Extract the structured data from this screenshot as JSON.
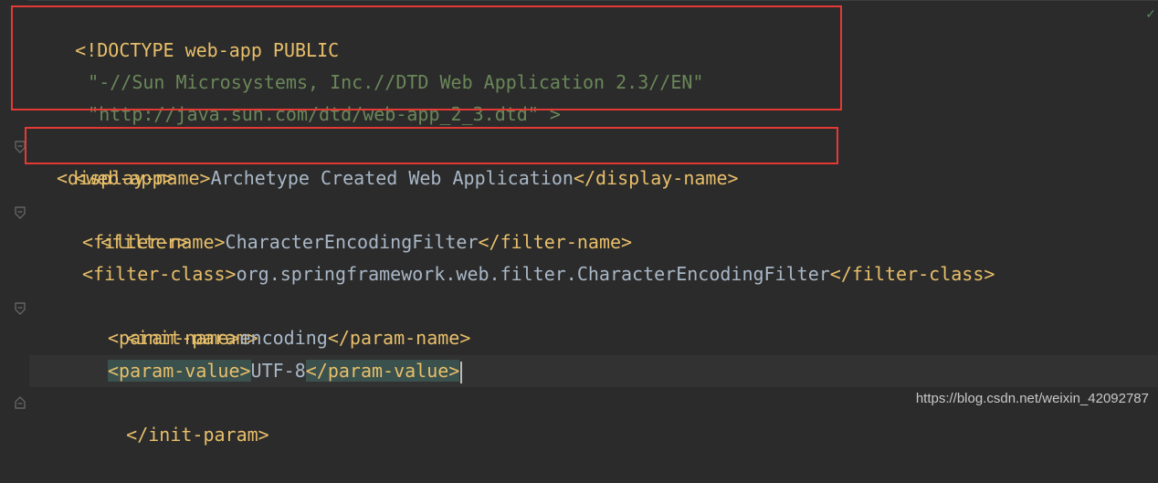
{
  "code_lines": [
    "<!DOCTYPE web-app PUBLIC",
    "\"-//Sun Microsystems, Inc.//DTD Web Application 2.3//EN\"",
    "\"http://java.sun.com/dtd/web-app_2_3.dtd\" >",
    "",
    "<web-app>",
    "<display-name>",
    "Archetype Created Web Application",
    "</display-name>",
    "<filter>",
    "<filter-name>",
    "CharacterEncodingFilter",
    "</filter-name>",
    "<filter-class>",
    "org.springframework.web.filter.CharacterEncodingFilter",
    "</filter-class>",
    "<init-param>",
    "<param-name>",
    "encoding",
    "</param-name>",
    "<param-value>",
    "UTF-8",
    "</param-value>",
    "</init-param>",
    ">"
  ],
  "watermark": "https://blog.csdn.net/weixin_42092787",
  "status_icon": "checkmark-icon",
  "colors": {
    "background": "#2b2b2b",
    "tag": "#e8bf6a",
    "string": "#6a8759",
    "text": "#a9b7c6",
    "highlight_box": "#e53935"
  }
}
